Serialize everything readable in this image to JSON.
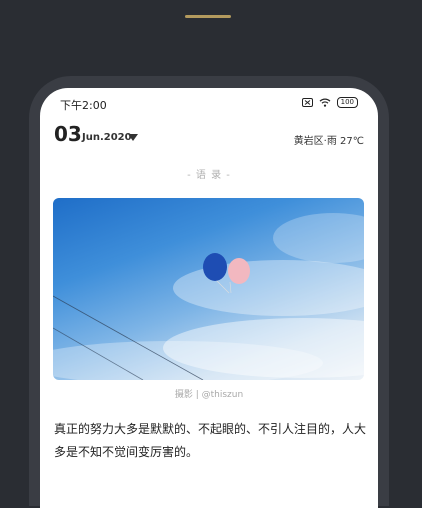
{
  "status": {
    "time": "下午2:00",
    "battery": "100",
    "icons": [
      "sim-off-icon",
      "wifi-icon",
      "battery-icon"
    ]
  },
  "date": {
    "day": "03",
    "month": "Jun.2020"
  },
  "weather": "黄岩区·雨 27℃",
  "section_label": "- 语 录 -",
  "photo": {
    "subject": "two balloons in blue sky",
    "caption": "摄影 | @thiszun"
  },
  "quote": "真正的努力大多是默默的、不起眼的、不引人注目的，人大多是不知不觉间变厉害的。",
  "colors": {
    "accent": "#b39a5e",
    "background": "#2a2d33",
    "frame": "#3a3d44"
  }
}
